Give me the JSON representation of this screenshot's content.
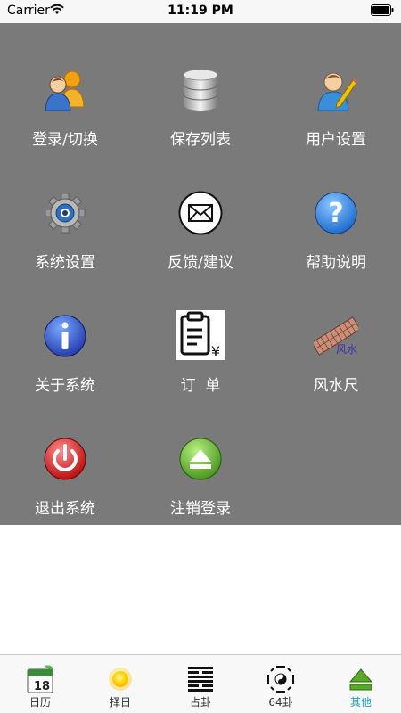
{
  "status_bar": {
    "carrier": "Carrier",
    "time": "11:19 PM"
  },
  "menu": {
    "items": [
      {
        "label": "登录/切换",
        "icon": "users-icon"
      },
      {
        "label": "保存列表",
        "icon": "database-icon"
      },
      {
        "label": "用户设置",
        "icon": "user-edit-icon"
      },
      {
        "label": "系统设置",
        "icon": "gear-icon"
      },
      {
        "label": "反馈/建议",
        "icon": "envelope-icon"
      },
      {
        "label": "帮助说明",
        "icon": "help-icon"
      },
      {
        "label": "关于系统",
        "icon": "info-icon"
      },
      {
        "label": "订  单",
        "icon": "order-clipboard-icon"
      },
      {
        "label": "风水尺",
        "icon": "fengshui-ruler-icon"
      },
      {
        "label": "退出系统",
        "icon": "power-icon"
      },
      {
        "label": "注销登录",
        "icon": "eject-icon"
      }
    ],
    "ruler_icon_text": "风水",
    "order_icon_symbol": "¥"
  },
  "tab_bar": {
    "tabs": [
      {
        "label": "日历",
        "icon": "calendar-icon",
        "active": false
      },
      {
        "label": "择日",
        "icon": "sun-icon",
        "active": false
      },
      {
        "label": "占卦",
        "icon": "hexagram-icon",
        "active": false
      },
      {
        "label": "64卦",
        "icon": "bagua-icon",
        "active": false
      },
      {
        "label": "其他",
        "icon": "eject-icon",
        "active": true
      }
    ],
    "calendar_day": "18"
  },
  "colors": {
    "panel_bg": "#7a7a7a",
    "label_text": "#ffffff",
    "active_tab": "#1aa1c0",
    "eject_green": "#5aa82a"
  }
}
